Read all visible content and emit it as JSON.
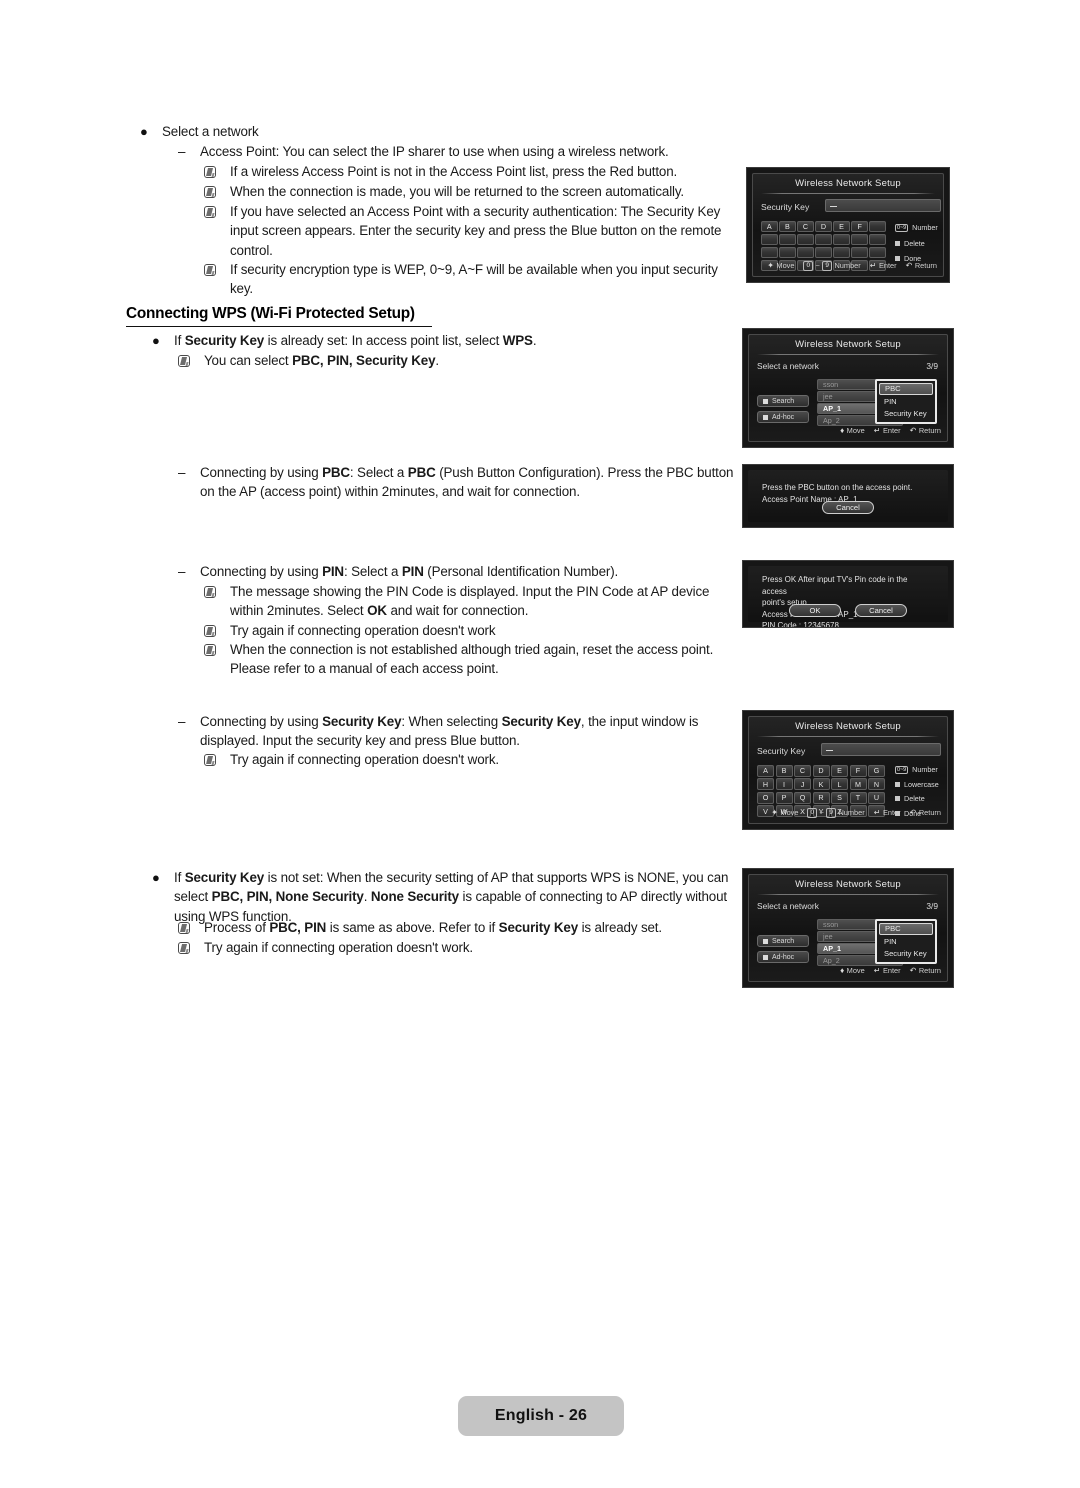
{
  "page": {
    "footer_label": "English - 26"
  },
  "body": {
    "b1": {
      "marker": "●",
      "text": "Select a network"
    },
    "b1_sub1": {
      "marker": "–",
      "text": "Access Point: You can select the IP sharer to use when using a wireless network."
    },
    "notes_access_point": [
      "If a wireless Access Point is not in the Access Point list, press the Red button.",
      "When the connection is made, you will be returned to the screen automatically.",
      "If you have selected an Access Point with a security authentication: The Security Key input screen appears. Enter the security key and press the Blue button on the remote control.",
      "If security encryption type is WEP, 0~9, A~F will be available when you input security key."
    ],
    "section_heading": "Connecting WPS (Wi-Fi Protected Setup)",
    "wps_bullet": {
      "marker": "●",
      "pre": "If ",
      "b1": "Security Key",
      "mid": " is already set: In access point list, select ",
      "b2": "WPS",
      "post": "."
    },
    "wps_note": {
      "pre": "You can select ",
      "b1": "PBC, PIN, Security Key",
      "post": "."
    },
    "pbc_item": {
      "marker": "–",
      "pre": "Connecting by using ",
      "b1": "PBC",
      "mid": ": Select a ",
      "b2": "PBC",
      "post": " (Push Button Configuration). Press the PBC button on the AP (access point) within 2minutes, and wait for connection."
    },
    "pin_item": {
      "marker": "–",
      "pre": "Connecting by using ",
      "b1": "PIN",
      "mid": ": Select a ",
      "b2": "PIN",
      "post": " (Personal Identification Number)."
    },
    "pin_notes": [
      {
        "pre": "The message showing the PIN Code is displayed. Input the PIN Code at AP device within 2minutes. Select ",
        "b1": "OK",
        "post": " and wait for connection."
      },
      {
        "pre": "Try again if connecting operation doesn't work",
        "b1": "",
        "post": ""
      },
      {
        "pre": "When the connection is not established although tried again, reset the access point. Please refer to a manual of each access point.",
        "b1": "",
        "post": ""
      }
    ],
    "seckey_item": {
      "marker": "–",
      "pre": "Connecting by using ",
      "b1": "Security Key",
      "mid": ": When selecting ",
      "b2": "Security Key",
      "post": ", the input window is displayed. Input the security key and press Blue button."
    },
    "seckey_note": "Try again if connecting operation doesn't work.",
    "notset_bullet": {
      "marker": "●",
      "pre": "If ",
      "b1": "Security Key",
      "mid": " is not set: When the security setting of AP that supports WPS is NONE, you can select ",
      "b2": "PBC, PIN, None Security",
      "mid2": ". ",
      "b3": "None Security",
      "post": " is capable of connecting to AP directly without using WPS function."
    },
    "notset_notes": [
      {
        "pre": "Process of ",
        "b1": "PBC, PIN",
        "mid": " is same as above. Refer to if ",
        "b2": "Security Key",
        "post": " is already set."
      },
      {
        "pre": "Try again if connecting operation doesn't work.",
        "b1": "",
        "mid": "",
        "b2": "",
        "post": ""
      }
    ]
  },
  "osd": {
    "title": "Wireless Network Setup",
    "security_key_label": "Security Key",
    "security_key_value": "",
    "nav": {
      "move": "Move",
      "number": "Number",
      "number_range_from": "0",
      "number_range_to": "9",
      "enter": "Enter",
      "return": "Return"
    },
    "keyboard_small": {
      "row1": [
        "A",
        "B",
        "C",
        "D",
        "E",
        "F",
        ""
      ],
      "row2": [
        "",
        "",
        "",
        "",
        "",
        "",
        ""
      ],
      "row3": [
        "",
        "",
        "",
        "",
        "",
        "",
        ""
      ],
      "row4": [
        "",
        "",
        "",
        "",
        "",
        "",
        ""
      ],
      "options": [
        "Number",
        "Delete",
        "Done"
      ]
    },
    "keyboard_large": {
      "row1": [
        "A",
        "B",
        "C",
        "D",
        "E",
        "F",
        "G"
      ],
      "row2": [
        "H",
        "I",
        "J",
        "K",
        "L",
        "M",
        "N"
      ],
      "row3": [
        "O",
        "P",
        "Q",
        "R",
        "S",
        "T",
        "U"
      ],
      "row4": [
        "V",
        "W",
        "X",
        "Y",
        "Z",
        "",
        ""
      ],
      "options": [
        "Number",
        "Lowercase",
        "Delete",
        "Done"
      ]
    },
    "select_network": {
      "label": "Select a network",
      "count": "3/9",
      "side_buttons": [
        "Search",
        "Ad-hoc"
      ],
      "ap_list": [
        "sson",
        "jee",
        "AP_1",
        "Ap_2"
      ],
      "selected_ap": "AP_1",
      "wps_menu": [
        "PBC",
        "PIN",
        "Security Key"
      ],
      "wps_selected": "PBC",
      "nav": {
        "move": "Move",
        "enter": "Enter",
        "return": "Return"
      }
    },
    "pbc_dialog": {
      "line1": "Press the PBC button on the access point.",
      "line2": "Access Point Name : AP_1",
      "cancel": "Cancel"
    },
    "pin_dialog": {
      "line1": "Press OK After input TV's Pin code in the access",
      "line2": "point's setup.",
      "line3": "Access Point Name : AP_1",
      "line4": "PIN Code : 12345678",
      "ok": "OK",
      "cancel": "Cancel"
    }
  }
}
